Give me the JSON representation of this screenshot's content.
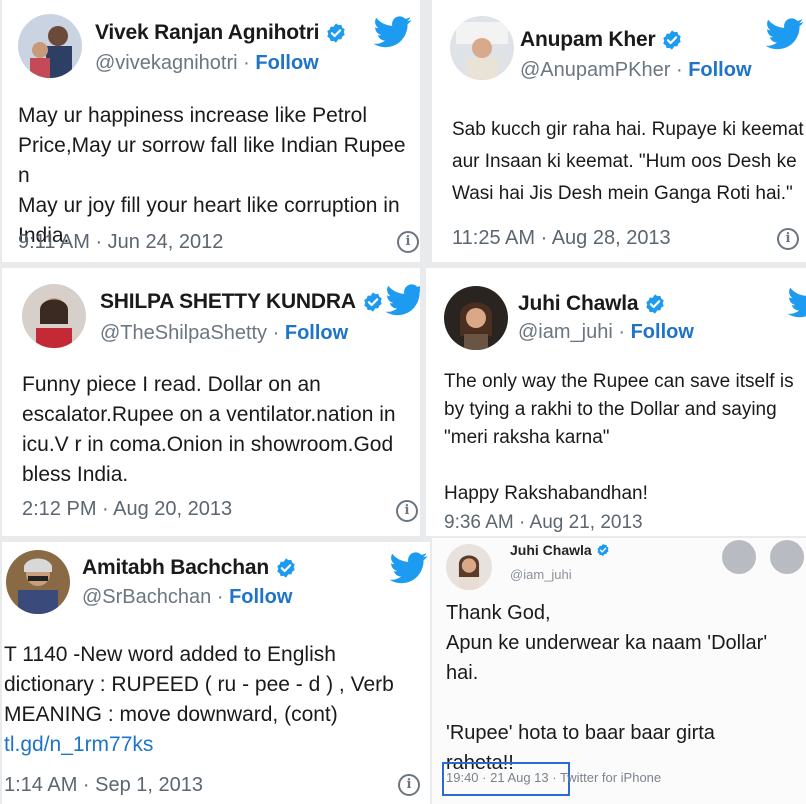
{
  "tweets": [
    {
      "name": "Vivek Ranjan Agnihotri",
      "handle": "@vivekagnihotri",
      "follow": "Follow",
      "separator": "·",
      "text": "May ur happiness increase like Petrol\nPrice,May ur sorrow fall like Indian Rupee n\nMay ur joy fill your heart like corruption in\nIndia.",
      "timestamp": "9:11 AM · Jun 24, 2012"
    },
    {
      "name": "Anupam Kher",
      "handle": "@AnupamPKher",
      "follow": "Follow",
      "separator": "·",
      "text": "Sab kucch gir raha hai. Rupaye ki keemat\naur Insaan ki keemat. \"Hum oos Desh ke\nWasi hai Jis Desh mein Ganga Roti hai.\"",
      "timestamp": "11:25 AM · Aug 28, 2013"
    },
    {
      "name": "SHILPA SHETTY KUNDRA",
      "handle": "@TheShilpaShetty",
      "follow": "Follow",
      "separator": "·",
      "text": "Funny piece I read. Dollar on an\nescalator.Rupee on a ventilator.nation in\nicu.V r in coma.Onion in showroom.God\nbless India.",
      "timestamp": "2:12 PM · Aug 20, 2013"
    },
    {
      "name": "Juhi Chawla",
      "handle": "@iam_juhi",
      "follow": "Follow",
      "separator": "·",
      "text": "The only way the Rupee can save itself is\nby tying a rakhi to the Dollar and saying\n\"meri raksha karna\"\n\nHappy Rakshabandhan!",
      "timestamp": "9:36 AM · Aug 21, 2013"
    },
    {
      "name": "Amitabh Bachchan",
      "handle": "@SrBachchan",
      "follow": "Follow",
      "separator": "·",
      "text": "T 1140 -New word added to English\ndictionary : RUPEED ( ru - pee - d ) , Verb\nMEANING : move downward, (cont)",
      "link": "tl.gd/n_1rm77ks",
      "timestamp": "1:14 AM · Sep 1, 2013"
    }
  ],
  "inner_tweet": {
    "name": "Juhi Chawla",
    "handle": "@iam_juhi",
    "text": "Thank God,\nApun ke underwear ka naam 'Dollar'\nhai.\n\n'Rupee' hota to baar baar girta\nraheta!!",
    "time": "19:40 · 21 Aug 13 ·",
    "source": "Twitter for iPhone"
  },
  "icons": {
    "verified": "verified-badge-icon",
    "bird": "twitter-bird-icon",
    "info": "info-icon"
  },
  "colors": {
    "twitter_blue": "#1d9bf0",
    "follow_blue": "#1d74c9",
    "highlight_box": "#2a6bd1"
  }
}
